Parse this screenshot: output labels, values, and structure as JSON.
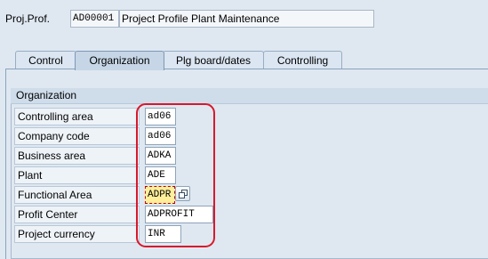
{
  "header": {
    "proj_prof_label": "Proj.Prof.",
    "proj_prof_value": "AD00001",
    "proj_prof_desc": "Project Profile Plant Maintenance"
  },
  "tabs": [
    {
      "label": "Control",
      "active": false
    },
    {
      "label": "Organization",
      "active": true
    },
    {
      "label": "Plg board/dates",
      "active": false
    },
    {
      "label": "Controlling",
      "active": false
    }
  ],
  "group": {
    "title": "Organization",
    "fields": [
      {
        "label": "Controlling area",
        "value": "ad06"
      },
      {
        "label": "Company code",
        "value": "ad06"
      },
      {
        "label": "Business area",
        "value": "ADKA"
      },
      {
        "label": "Plant",
        "value": "ADE"
      },
      {
        "label": "Functional Area",
        "value": "ADPR"
      },
      {
        "label": "Profit Center",
        "value": "ADPROFIT"
      },
      {
        "label": "Project currency",
        "value": "INR"
      }
    ]
  },
  "icons": {
    "value_help": "value-help-icon"
  },
  "colors": {
    "background": "#dfe8f1",
    "focus_field": "#ffef9a",
    "annotation_ring": "#d8182d"
  }
}
